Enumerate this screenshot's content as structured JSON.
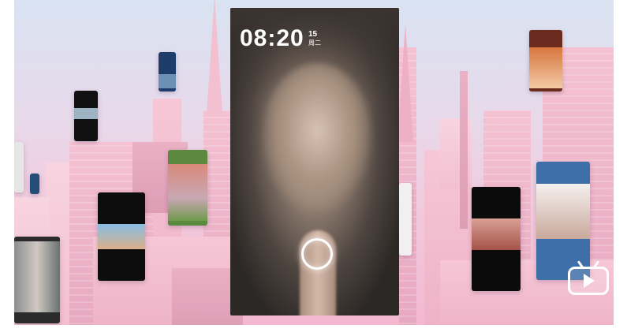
{
  "lockscreen": {
    "time": "08:20",
    "day": "15",
    "weekday": "周二"
  },
  "colors": {
    "sky_top": "#d9e3f2",
    "city_pink": "#f3b8cf",
    "accent_white": "#ffffff"
  },
  "icons": {
    "logo": "bilibili-tv-icon",
    "touch": "touch-ring-icon"
  }
}
